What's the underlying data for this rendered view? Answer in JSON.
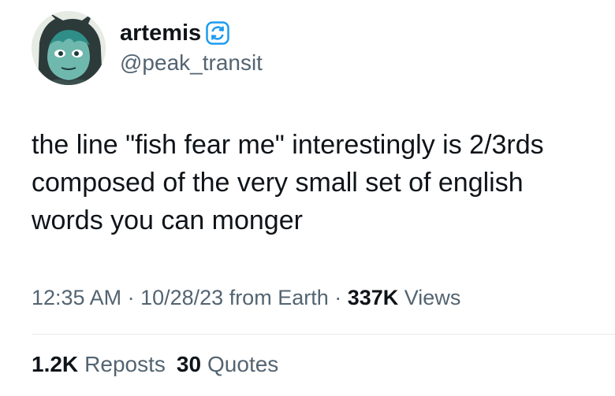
{
  "author": {
    "display_name": "artemis",
    "handle": "@peak_transit",
    "badge_icon": "refresh-badge-icon",
    "badge_color": "#1d9bf0",
    "avatar_icon": "cat-character-avatar"
  },
  "tweet": {
    "lines": [
      "the line \"fish fear me\" interestingly is 2/3rds",
      "composed of the very small set of english",
      "words you can monger"
    ]
  },
  "meta": {
    "time": "12:35 AM",
    "sep1": " · ",
    "date": "10/28/23",
    "source": " from Earth",
    "sep2": " · ",
    "views_count": "337K",
    "views_label": " Views"
  },
  "stats": {
    "reposts_count": "1.2K",
    "reposts_label": "Reposts",
    "quotes_count": "30",
    "quotes_label": "Quotes"
  },
  "colors": {
    "text_primary": "#0f1419",
    "text_secondary": "#536471",
    "divider": "#e7e9ea",
    "accent": "#1d9bf0"
  }
}
